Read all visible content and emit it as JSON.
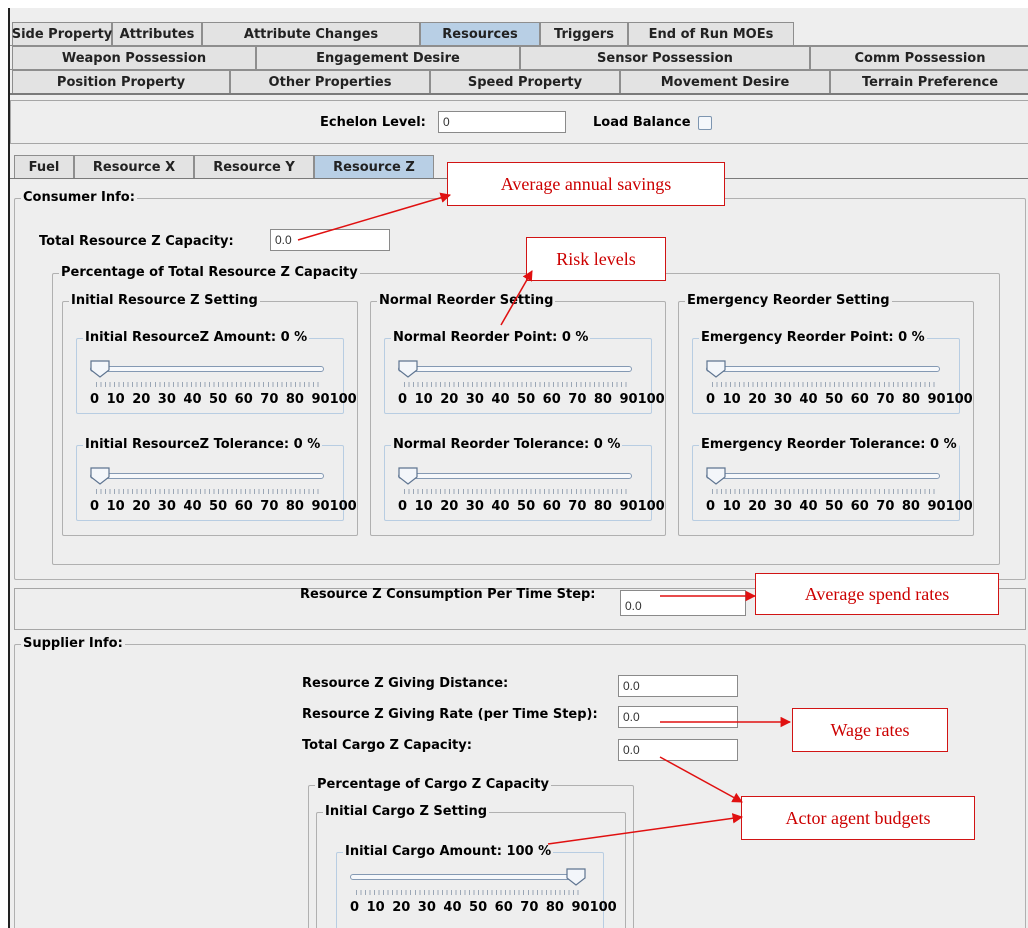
{
  "tabs": {
    "row1": [
      "Side Property",
      "Attributes",
      "Attribute Changes",
      "Resources",
      "Triggers",
      "End of Run MOEs"
    ],
    "row2": [
      "Weapon Possession",
      "Engagement Desire",
      "Sensor Possession",
      "Comm Possession"
    ],
    "row3": [
      "Position Property",
      "Other Properties",
      "Speed Property",
      "Movement Desire",
      "Terrain Preference"
    ],
    "active": "Resources"
  },
  "echelon": {
    "label": "Echelon Level:",
    "value": "0"
  },
  "load_balance": {
    "label": "Load Balance",
    "checked": false
  },
  "resource_tabs": {
    "items": [
      "Fuel",
      "Resource X",
      "Resource Y",
      "Resource Z"
    ],
    "active": "Resource Z"
  },
  "consumer": {
    "title": "Consumer Info:",
    "total_capacity_label": "Total Resource Z Capacity:",
    "total_capacity_value": "0.0",
    "percentage_title": "Percentage of Total Resource Z Capacity",
    "initial": {
      "title": "Initial Resource Z Setting",
      "amount_label": "Initial ResourceZ Amount: 0 %",
      "amount_value": 0,
      "tolerance_label": "Initial ResourceZ Tolerance: 0 %",
      "tolerance_value": 0
    },
    "normal": {
      "title": "Normal Reorder Setting",
      "point_label": "Normal Reorder Point: 0 %",
      "point_value": 0,
      "tolerance_label": "Normal Reorder Tolerance: 0 %",
      "tolerance_value": 0
    },
    "emergency": {
      "title": "Emergency Reorder Setting",
      "point_label": "Emergency Reorder Point: 0 %",
      "point_value": 0,
      "tolerance_label": "Emergency Reorder Tolerance: 0 %",
      "tolerance_value": 0
    },
    "slider_scale": "0 10 20 30 40 50 60 70 80 90100"
  },
  "consumption": {
    "label": "Resource Z Consumption Per Time Step:",
    "value": "0.0"
  },
  "supplier": {
    "title": "Supplier Info:",
    "giving_distance_label": "Resource Z Giving Distance:",
    "giving_distance_value": "0.0",
    "giving_rate_label": "Resource Z Giving Rate (per Time Step):",
    "giving_rate_value": "0.0",
    "cargo_capacity_label": "Total Cargo Z Capacity:",
    "cargo_capacity_value": "0.0",
    "cargo_percentage_title": "Percentage of Cargo Z Capacity",
    "initial_cargo_title": "Initial Cargo Z Setting",
    "initial_cargo_label": "Initial Cargo Amount: 100 %",
    "initial_cargo_value": 100
  },
  "callouts": {
    "annual_savings": "Average annual savings",
    "risk_levels": "Risk levels",
    "spend_rates": "Average spend rates",
    "wage_rates": "Wage rates",
    "budgets": "Actor agent budgets"
  },
  "colors": {
    "active_tab": "#b8cfe5",
    "callout_red": "#cc0000",
    "window_bg": "#eeeeee"
  }
}
